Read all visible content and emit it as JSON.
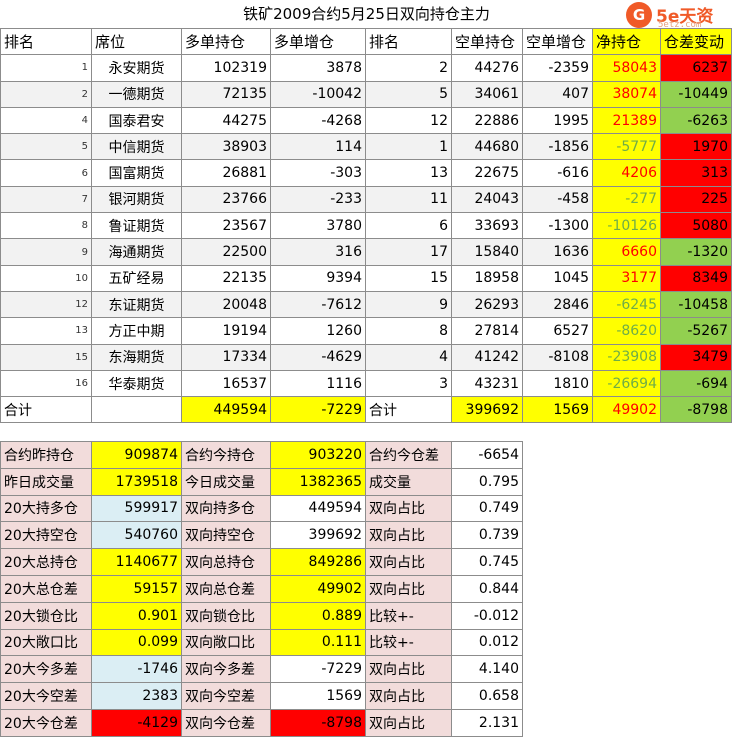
{
  "title": "铁矿2009合约5月25日双向持仓主力",
  "logo": {
    "mark": "G",
    "brand": "5e天资",
    "site": "5etz.com"
  },
  "colors": {
    "yellow": "#ffff00",
    "red": "#ff0000",
    "green": "#92d050",
    "pink": "#f2dcdb",
    "blue": "#dbeef4"
  },
  "headers": [
    "排名",
    "席位",
    "多单持仓",
    "多单增仓",
    "排名",
    "空单持仓",
    "空单增仓",
    "净持仓",
    "仓差变动"
  ],
  "rows": [
    {
      "rank": "1",
      "name": "永安期货",
      "long": "102319",
      "long_chg": "3878",
      "srank": "2",
      "short": "44276",
      "short_chg": "-2359",
      "net": "58043",
      "net_color": "red",
      "diff": "6237",
      "diff_bg": "red"
    },
    {
      "rank": "2",
      "name": "一德期货",
      "long": "72135",
      "long_chg": "-10042",
      "srank": "5",
      "short": "34061",
      "short_chg": "407",
      "net": "38074",
      "net_color": "red",
      "diff": "-10449",
      "diff_bg": "green"
    },
    {
      "rank": "4",
      "name": "国泰君安",
      "long": "44275",
      "long_chg": "-4268",
      "srank": "12",
      "short": "22886",
      "short_chg": "1995",
      "net": "21389",
      "net_color": "red",
      "diff": "-6263",
      "diff_bg": "green"
    },
    {
      "rank": "5",
      "name": "中信期货",
      "long": "38903",
      "long_chg": "114",
      "srank": "1",
      "short": "44680",
      "short_chg": "-1856",
      "net": "-5777",
      "net_color": "green",
      "diff": "1970",
      "diff_bg": "red"
    },
    {
      "rank": "6",
      "name": "国富期货",
      "long": "26881",
      "long_chg": "-303",
      "srank": "13",
      "short": "22675",
      "short_chg": "-616",
      "net": "4206",
      "net_color": "red",
      "diff": "313",
      "diff_bg": "red"
    },
    {
      "rank": "7",
      "name": "银河期货",
      "long": "23766",
      "long_chg": "-233",
      "srank": "11",
      "short": "24043",
      "short_chg": "-458",
      "net": "-277",
      "net_color": "green",
      "diff": "225",
      "diff_bg": "red"
    },
    {
      "rank": "8",
      "name": "鲁证期货",
      "long": "23567",
      "long_chg": "3780",
      "srank": "6",
      "short": "33693",
      "short_chg": "-1300",
      "net": "-10126",
      "net_color": "green",
      "diff": "5080",
      "diff_bg": "red"
    },
    {
      "rank": "9",
      "name": "海通期货",
      "long": "22500",
      "long_chg": "316",
      "srank": "17",
      "short": "15840",
      "short_chg": "1636",
      "net": "6660",
      "net_color": "red",
      "diff": "-1320",
      "diff_bg": "green"
    },
    {
      "rank": "10",
      "name": "五矿经易",
      "long": "22135",
      "long_chg": "9394",
      "srank": "15",
      "short": "18958",
      "short_chg": "1045",
      "net": "3177",
      "net_color": "red",
      "diff": "8349",
      "diff_bg": "red"
    },
    {
      "rank": "12",
      "name": "东证期货",
      "long": "20048",
      "long_chg": "-7612",
      "srank": "9",
      "short": "26293",
      "short_chg": "2846",
      "net": "-6245",
      "net_color": "green",
      "diff": "-10458",
      "diff_bg": "green"
    },
    {
      "rank": "13",
      "name": "方正中期",
      "long": "19194",
      "long_chg": "1260",
      "srank": "8",
      "short": "27814",
      "short_chg": "6527",
      "net": "-8620",
      "net_color": "green",
      "diff": "-5267",
      "diff_bg": "green"
    },
    {
      "rank": "15",
      "name": "东海期货",
      "long": "17334",
      "long_chg": "-4629",
      "srank": "4",
      "short": "41242",
      "short_chg": "-8108",
      "net": "-23908",
      "net_color": "green",
      "diff": "3479",
      "diff_bg": "red"
    },
    {
      "rank": "16",
      "name": "华泰期货",
      "long": "16537",
      "long_chg": "1116",
      "srank": "3",
      "short": "43231",
      "short_chg": "1810",
      "net": "-26694",
      "net_color": "green",
      "diff": "-694",
      "diff_bg": "green"
    }
  ],
  "total": {
    "label": "合计",
    "long": "449594",
    "long_chg": "-7229",
    "label2": "合计",
    "short": "399692",
    "short_chg": "1569",
    "net": "49902",
    "diff": "-8798"
  },
  "stats": [
    {
      "l1": "合约昨持仓",
      "v1": "909874",
      "v1bg": "yellow",
      "l2": "合约今持仓",
      "v2": "903220",
      "v2bg": "yellow",
      "l3": "合约今仓差",
      "v3": "-6654"
    },
    {
      "l1": "昨日成交量",
      "v1": "1739518",
      "v1bg": "yellow",
      "l2": "今日成交量",
      "v2": "1382365",
      "v2bg": "yellow",
      "l3": "成交量",
      "v3": "0.795"
    },
    {
      "l1": "20大持多仓",
      "v1": "599917",
      "v1bg": "blue",
      "l2": "双向持多仓",
      "v2": "449594",
      "v2bg": "none",
      "l3": "双向占比",
      "v3": "0.749"
    },
    {
      "l1": "20大持空仓",
      "v1": "540760",
      "v1bg": "blue",
      "l2": "双向持空仓",
      "v2": "399692",
      "v2bg": "none",
      "l3": "双向占比",
      "v3": "0.739"
    },
    {
      "l1": "20大总持仓",
      "v1": "1140677",
      "v1bg": "yellow",
      "l2": "双向总持仓",
      "v2": "849286",
      "v2bg": "yellow",
      "l3": "双向占比",
      "v3": "0.745"
    },
    {
      "l1": "20大总仓差",
      "v1": "59157",
      "v1bg": "yellow",
      "l2": "双向总仓差",
      "v2": "49902",
      "v2bg": "yellow",
      "l3": "双向占比",
      "v3": "0.844"
    },
    {
      "l1": "20大锁仓比",
      "v1": "0.901",
      "v1bg": "yellow",
      "l2": "双向锁仓比",
      "v2": "0.889",
      "v2bg": "yellow",
      "l3": "比较+-",
      "v3": "-0.012"
    },
    {
      "l1": "20大敞口比",
      "v1": "0.099",
      "v1bg": "yellow",
      "l2": "双向敞口比",
      "v2": "0.111",
      "v2bg": "yellow",
      "l3": "比较+-",
      "v3": "0.012"
    },
    {
      "l1": "20大今多差",
      "v1": "-1746",
      "v1bg": "blue",
      "l2": "双向今多差",
      "v2": "-7229",
      "v2bg": "none",
      "l3": "双向占比",
      "v3": "4.140"
    },
    {
      "l1": "20大今空差",
      "v1": "2383",
      "v1bg": "blue",
      "l2": "双向今空差",
      "v2": "1569",
      "v2bg": "none",
      "l3": "双向占比",
      "v3": "0.658"
    },
    {
      "l1": "20大今仓差",
      "v1": "-4129",
      "v1bg": "red",
      "l2": "双向今仓差",
      "v2": "-8798",
      "v2bg": "red",
      "l3": "双向占比",
      "v3": "2.131"
    }
  ]
}
